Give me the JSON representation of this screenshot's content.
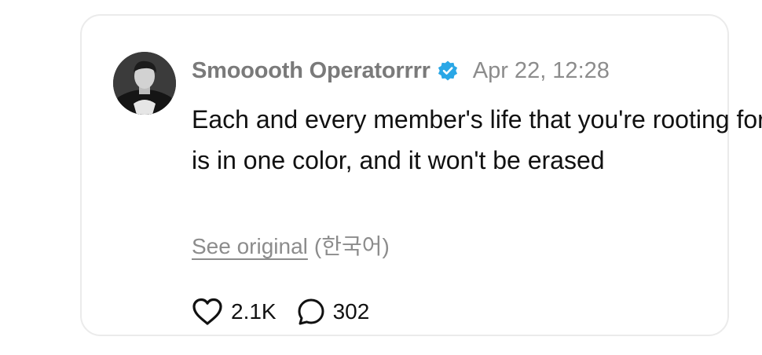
{
  "post": {
    "username": "Smooooth Operatorrrr",
    "verified": true,
    "timestamp": "Apr 22, 12:28",
    "text": "Each and every member's life that you're rooting for is in one color, and it won't be erased",
    "see_original_label": "See original",
    "original_language": "(한국어)",
    "like_count": "2.1K",
    "reply_count": "302"
  },
  "icons": {
    "verified": "verified-badge-icon",
    "more": "more-vertical-icon",
    "like": "heart-icon",
    "reply": "speech-bubble-icon"
  },
  "colors": {
    "verified_badge": "#2aa7e6",
    "muted_text": "#8c8c8c",
    "main_text": "#111111",
    "card_border": "#ebebeb"
  }
}
